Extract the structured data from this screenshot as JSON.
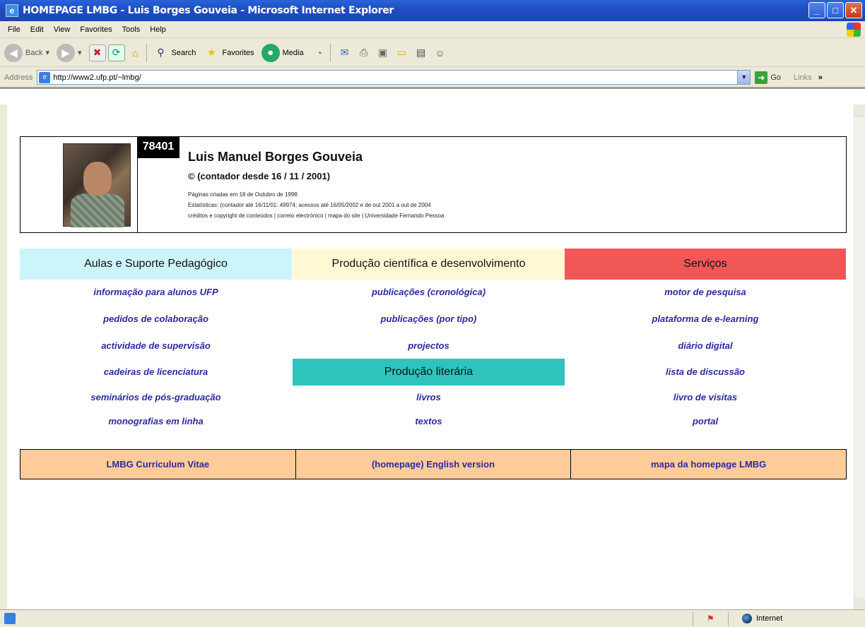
{
  "window": {
    "title": "HOMEPAGE LMBG - Luis Borges Gouveia - Microsoft Internet Explorer"
  },
  "menu": [
    "File",
    "Edit",
    "View",
    "Favorites",
    "Tools",
    "Help"
  ],
  "toolbar": {
    "back": "Back",
    "search": "Search",
    "favorites": "Favorites",
    "media": "Media"
  },
  "address": {
    "label": "Address",
    "url": "http://www2.ufp.pt/~lmbg/",
    "go": "Go",
    "links": "Links"
  },
  "header": {
    "counter": "78401",
    "name": "Luis Manuel Borges Gouveia",
    "counter_since": "© (contador desde 16 / 11 / 2001)",
    "line1": "Páginas criadas em 18 de Outubro de 1998",
    "line2": "Estatísticas: (contador até 16/11/01: 49974; acessos até 16/05/2002 e de out 2001 a out de 2004",
    "line3": "créditos e copyright de conteúdos | correio electrónico | mapa do site | Universidade Fernando Pessoa"
  },
  "sections": {
    "aulas": "Aulas e Suporte Pedagógico",
    "producao": "Produção científica e desenvolvimento",
    "servicos": "Serviços",
    "literaria": "Produção literária"
  },
  "col1": [
    "informação para  alunos UFP",
    "pedidos de colaboração",
    "actividade de  supervisão",
    "cadeiras de licenciatura",
    "seminários de pós-graduação",
    "monografias em linha"
  ],
  "col2": [
    "publicações (cronológica)",
    "publicações (por tipo)",
    "projectos",
    "livros",
    "textos"
  ],
  "col3": [
    "motor de pesquisa",
    "plataforma de e-learning",
    "diário digital",
    "lista de discussão",
    "livro de visitas",
    "portal"
  ],
  "bottom": [
    "LMBG Curriculum Vitae",
    "(homepage) English version",
    "mapa da homepage LMBG"
  ],
  "status": {
    "zone": "Internet"
  }
}
